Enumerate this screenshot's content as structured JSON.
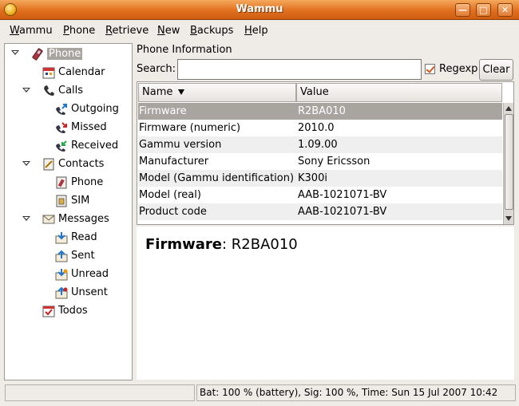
{
  "window": {
    "title": "Wammu"
  },
  "menu": [
    {
      "u": "W",
      "rest": "ammu"
    },
    {
      "u": "P",
      "rest": "hone"
    },
    {
      "u": "R",
      "rest": "etrieve"
    },
    {
      "u": "N",
      "rest": "ew"
    },
    {
      "u": "B",
      "rest": "ackups"
    },
    {
      "u": "H",
      "rest": "elp"
    }
  ],
  "tree": {
    "phone": "Phone",
    "calendar": "Calendar",
    "calls": "Calls",
    "outgoing": "Outgoing",
    "missed": "Missed",
    "received": "Received",
    "contacts": "Contacts",
    "contacts_phone": "Phone",
    "sim": "SIM",
    "messages": "Messages",
    "read": "Read",
    "sent": "Sent",
    "unread": "Unread",
    "unsent": "Unsent",
    "todos": "Todos"
  },
  "panel": {
    "title": "Phone Information",
    "search_label": "Search:",
    "search_value": "",
    "regexp_label": "Regexp",
    "regexp_checked": true,
    "clear_label": "Clear",
    "col_name": "Name",
    "col_value": "Value"
  },
  "rows": [
    {
      "name": "Firmware",
      "value": "R2BA010"
    },
    {
      "name": "Firmware (numeric)",
      "value": "2010.0"
    },
    {
      "name": "Gammu version",
      "value": "1.09.00"
    },
    {
      "name": "Manufacturer",
      "value": "Sony Ericsson"
    },
    {
      "name": "Model (Gammu identification)",
      "value": "K300i"
    },
    {
      "name": "Model (real)",
      "value": "AAB-1021071-BV"
    },
    {
      "name": "Product code",
      "value": "AAB-1021071-BV"
    }
  ],
  "detail": {
    "label": "Firmware",
    "sep": ": ",
    "value": "R2BA010"
  },
  "status": {
    "left": "",
    "right": "Bat: 100 % (battery), Sig: 100 %, Time: Sun 15 Jul 2007 10:42"
  },
  "colors": {
    "selection": "#a8a5a1",
    "titlebar": "#e0701e",
    "check": "#d2561d"
  }
}
